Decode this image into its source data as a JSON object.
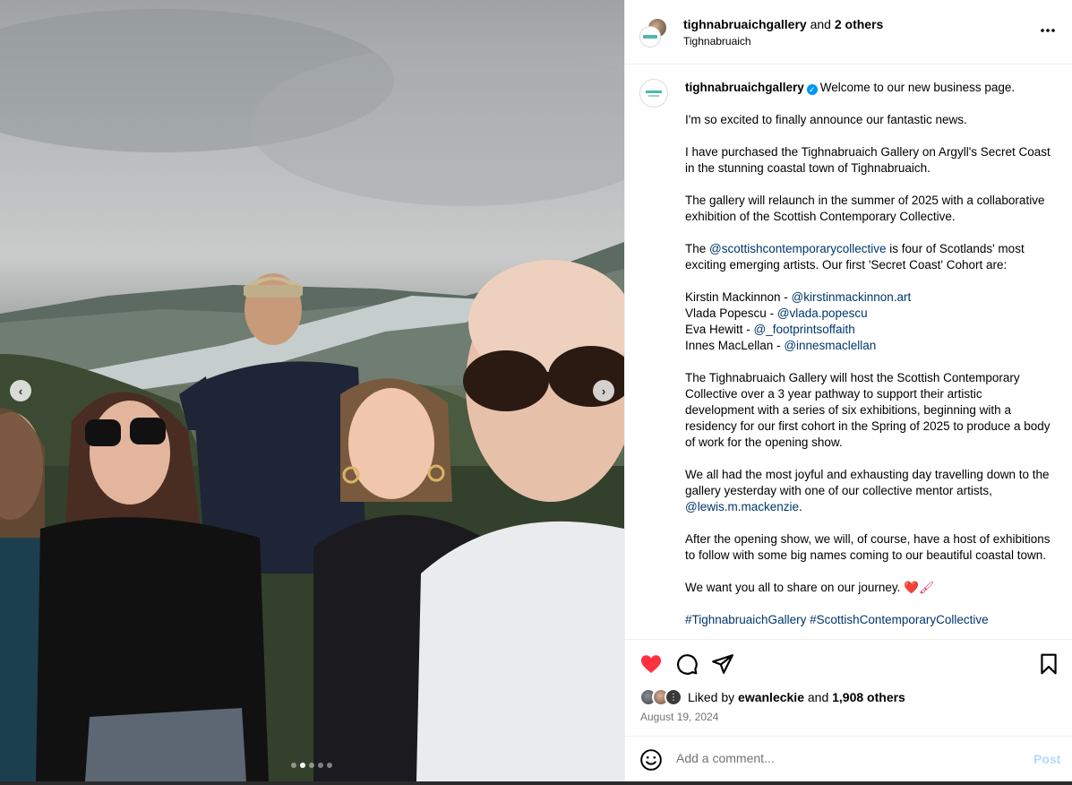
{
  "header": {
    "username": "tighnabruaichgallery",
    "and_text": " and ",
    "others": "2 others",
    "location": "Tighnabruaich",
    "more_icon": "more-horizontal-icon"
  },
  "caption": {
    "username": "tighnabruaichgallery",
    "verified_icon": "verified-badge-icon",
    "lines": {
      "welcome": "Welcome to our new business page.",
      "p1": "I'm so excited to finally announce our fantastic news.",
      "p2": "I have purchased the Tighnabruaich Gallery on Argyll's Secret Coast in the stunning coastal town of Tighnabruaich.",
      "p3": "The gallery will relaunch in the summer of 2025 with a collaborative exhibition of the Scottish Contemporary Collective.",
      "p4_pre": "The ",
      "p4_mention": "@scottishcontemporarycollective",
      "p4_post": " is four of Scotlands' most exciting emerging artists. Our first 'Secret Coast' Cohort are:",
      "artists": [
        {
          "name": "Kirstin Mackinnon - ",
          "handle": "@kirstinmackinnon.art"
        },
        {
          "name": "Vlada Popescu - ",
          "handle": "@vlada.popescu"
        },
        {
          "name": "Eva Hewitt - ",
          "handle": "@_footprintsoffaith"
        },
        {
          "name": "Innes MacLellan - ",
          "handle": "@innesmaclellan"
        }
      ],
      "p5": "The Tighnabruaich Gallery will host the Scottish Contemporary Collective over a 3 year pathway to support their artistic development with a series of six exhibitions, beginning with a residency for our first cohort in the Spring of 2025 to produce a body of work for the opening show.",
      "p6_pre": "We all had the most joyful and exhausting day travelling down to the gallery yesterday with one of our collective mentor artists, ",
      "p6_mention": "@lewis.m.mackenzie",
      "p6_post": ".",
      "p7": "After the opening show, we will, of course, have a host of exhibitions to follow with some big names coming to our beautiful coastal town.",
      "p8": "We want you all to share on our journey. ",
      "p8_emoji": "❤️🖌",
      "hashtags": "#TighnabruaichGallery #ScottishContemporaryCollective"
    }
  },
  "actions": {
    "like_icon": "heart-filled-icon",
    "comment_icon": "comment-icon",
    "share_icon": "share-icon",
    "save_icon": "bookmark-icon"
  },
  "likes": {
    "prefix": "Liked by ",
    "user": "ewanleckie",
    "middle": " and ",
    "count": "1,908 others"
  },
  "date": "August 19, 2024",
  "comment": {
    "placeholder": "Add a comment...",
    "post_label": "Post",
    "emoji_icon": "emoji-smile-icon"
  },
  "carousel": {
    "total": 5,
    "active_index": 1
  },
  "colors": {
    "accent": "#0095f6",
    "mention": "#00376b",
    "like_red": "#ff3040",
    "post_disabled": "#b3dbff",
    "secondary_text": "#737373"
  }
}
